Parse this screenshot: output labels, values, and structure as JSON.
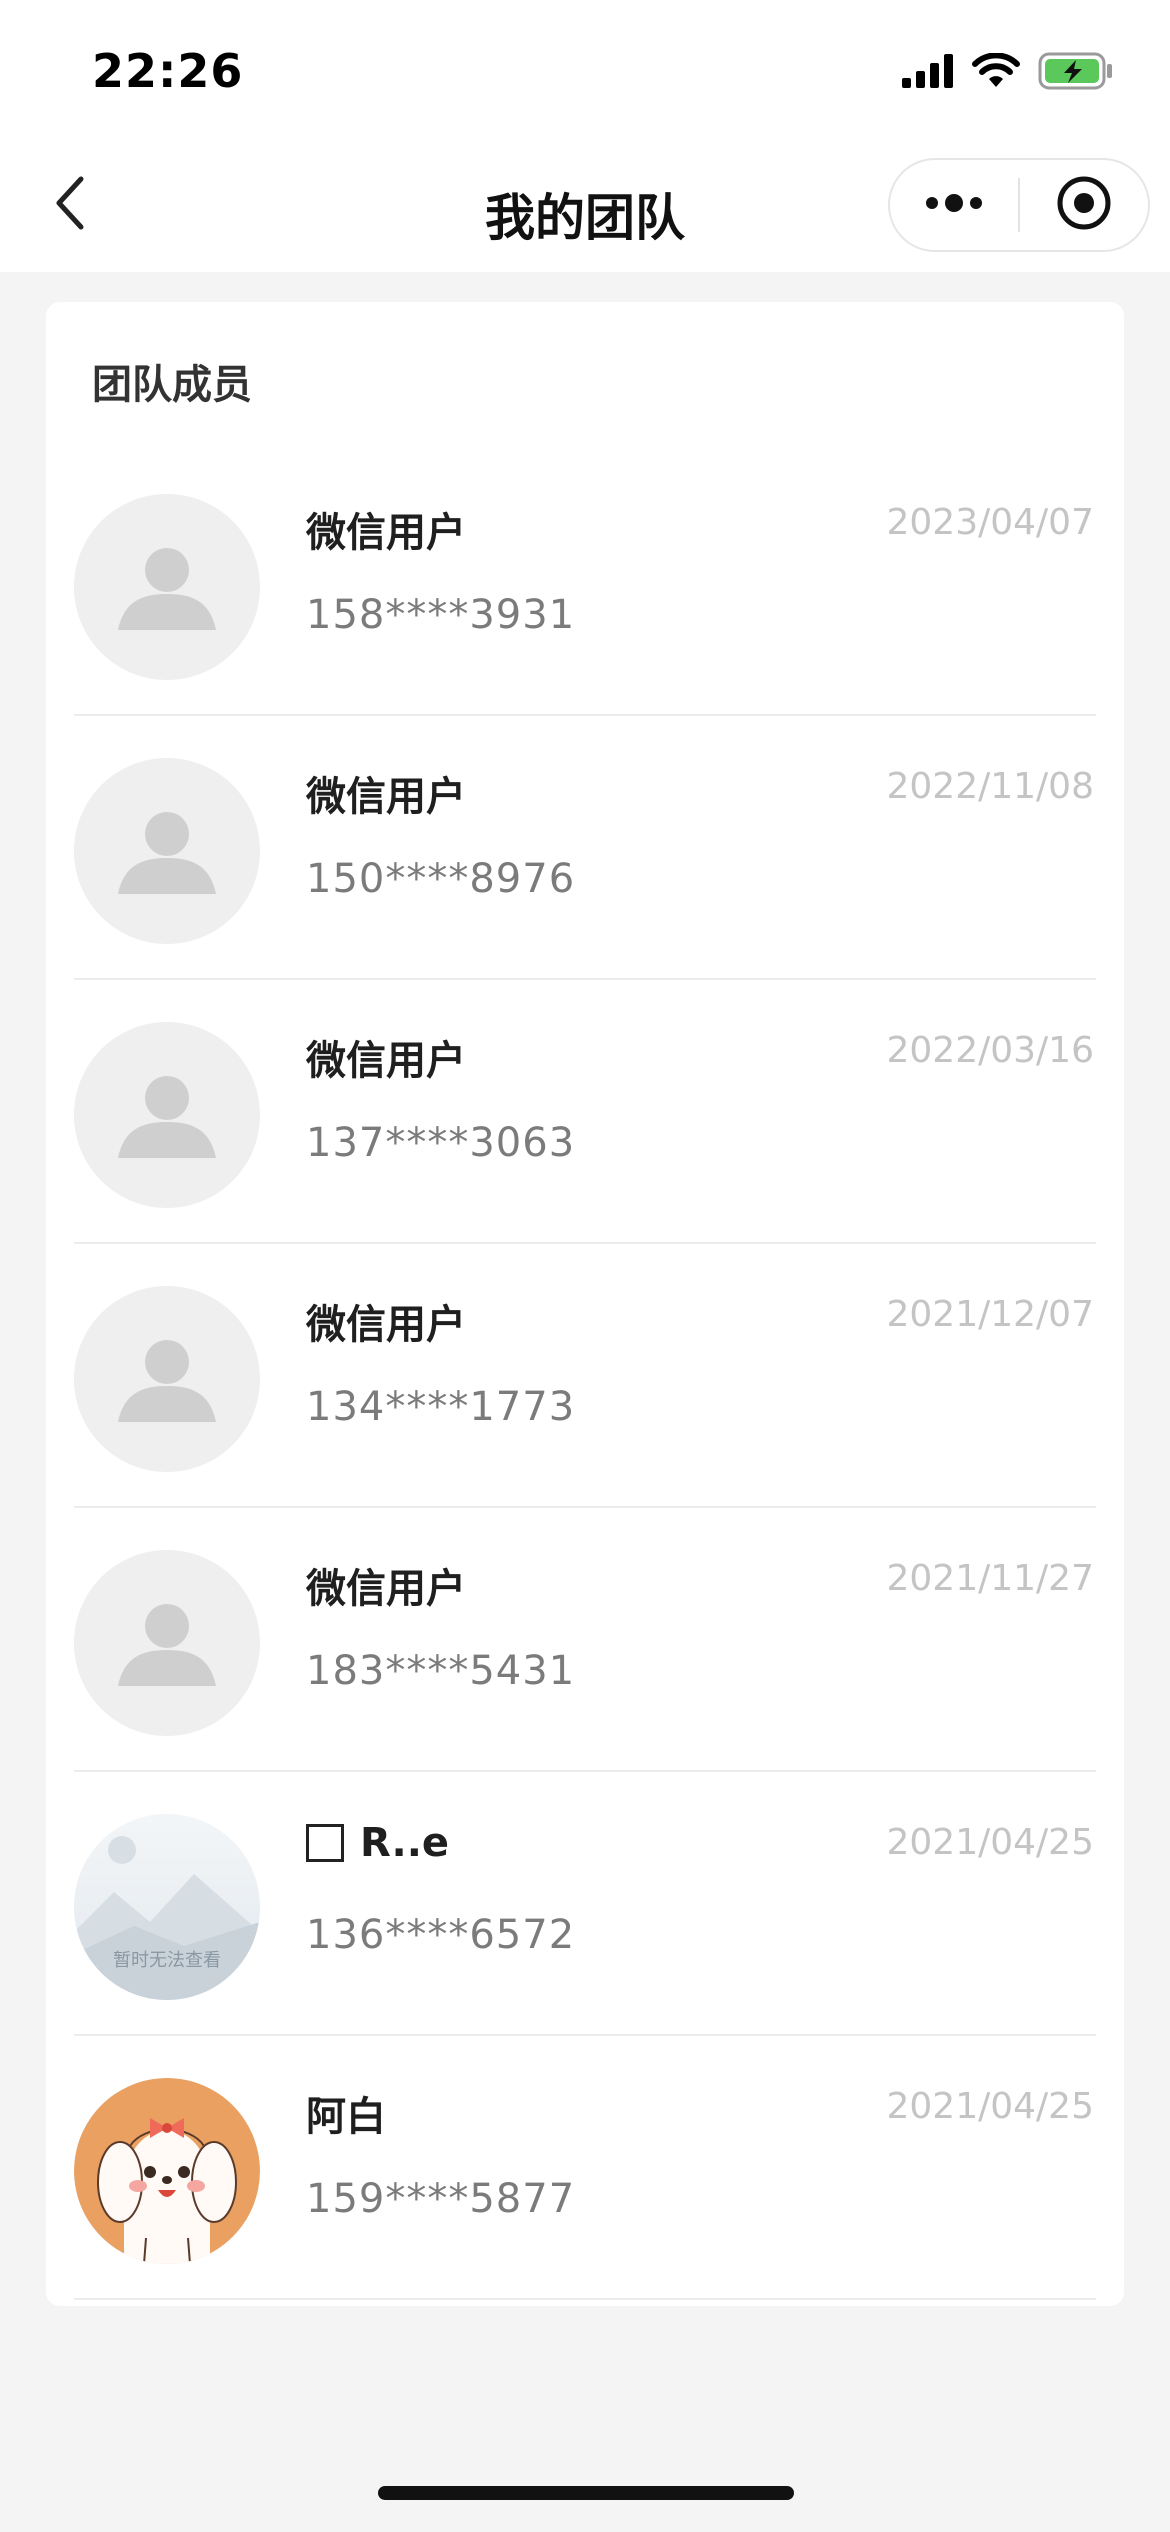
{
  "status_bar": {
    "time": "22:26",
    "icons": [
      "signal-icon",
      "wifi-icon",
      "battery-charging-icon"
    ]
  },
  "nav": {
    "title": "我的团队",
    "back_icon": "chevron-left-icon",
    "more_icon": "more-dots-icon",
    "close_icon": "target-circle-icon"
  },
  "section": {
    "title": "团队成员"
  },
  "members": [
    {
      "name": "微信用户",
      "phone": "158****3931",
      "date": "2023/04/07",
      "avatar": "default-avatar-icon"
    },
    {
      "name": "微信用户",
      "phone": "150****8976",
      "date": "2022/11/08",
      "avatar": "default-avatar-icon"
    },
    {
      "name": "微信用户",
      "phone": "137****3063",
      "date": "2022/03/16",
      "avatar": "default-avatar-icon"
    },
    {
      "name": "微信用户",
      "phone": "134****1773",
      "date": "2021/12/07",
      "avatar": "default-avatar-icon"
    },
    {
      "name": "微信用户",
      "phone": "183****5431",
      "date": "2021/11/27",
      "avatar": "default-avatar-icon"
    },
    {
      "name": "R..e",
      "phone": "136****6572",
      "date": "2021/04/25",
      "avatar": "image-unavailable-icon",
      "avatar_caption": "暂时无法查看"
    },
    {
      "name": "阿白",
      "phone": "159****5877",
      "date": "2021/04/25",
      "avatar": "cartoon-dog-avatar"
    }
  ],
  "colors": {
    "background": "#f4f4f4",
    "card": "#ffffff",
    "date_text": "#c4c4c4",
    "phone_text": "#7b7b7b",
    "battery_fill": "#5ac85a"
  }
}
